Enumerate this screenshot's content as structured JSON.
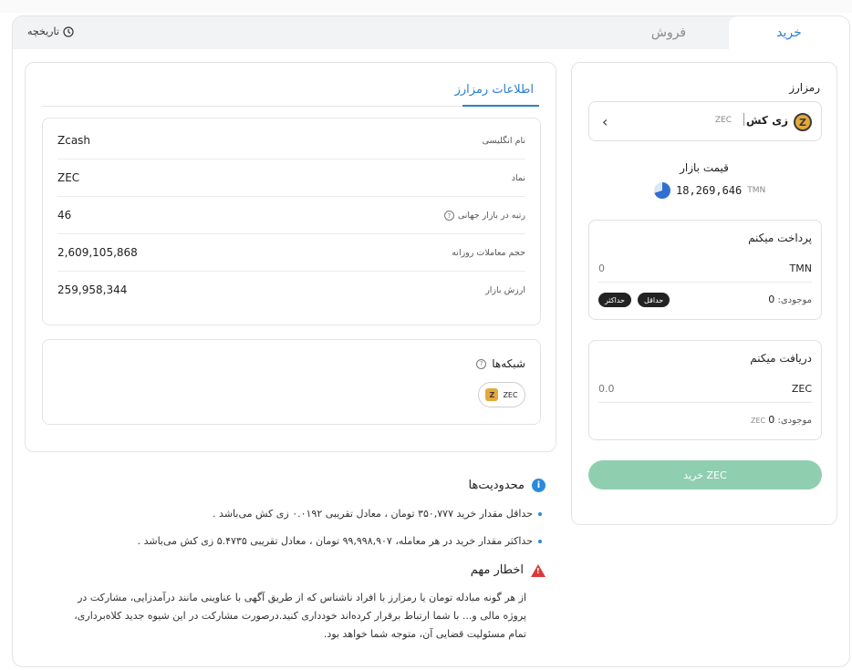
{
  "tabs": {
    "buy": "خرید",
    "sell": "فروش",
    "history": "تاریخچه"
  },
  "trade": {
    "crypto_label": "رمزارز",
    "coin_name": "زی کش",
    "coin_symbol": "ZEC",
    "coin_logo_letter": "Z",
    "market_price_label": "قیمت بازار",
    "market_price_value": "18,269,646",
    "market_price_unit": "TMN",
    "pay": {
      "title": "پرداخت میکنم",
      "value": "0",
      "currency": "TMN",
      "balance_label": "موجودی:",
      "balance_value": "0",
      "min_label": "حداقل",
      "max_label": "حداکثر"
    },
    "receive": {
      "title": "دریافت میکنم",
      "value": "0.0",
      "currency": "ZEC",
      "balance_label": "موجودی:",
      "balance_unit": "ZEC",
      "balance_value": "0"
    },
    "buy_button": "خرید ZEC"
  },
  "info": {
    "tab_label": "اطلاعات رمزارز",
    "rows": [
      {
        "key": "نام انگلیسی",
        "value": "Zcash"
      },
      {
        "key": "نماد",
        "value": "ZEC"
      },
      {
        "key": "رتبه در بازار جهانی",
        "value": "46"
      },
      {
        "key": "حجم معاملات روزانه",
        "value": "2,609,105,868"
      },
      {
        "key": "ارزش بازار",
        "value": "259,958,344"
      }
    ],
    "networks_label": "شبکه‌ها",
    "network_chip": "ZEC"
  },
  "restrictions": {
    "title": "محدودیت‌ها",
    "items": [
      "حداقل مقدار خرید ۳۵۰,۷۷۷ تومان ، معادل تقریبی ۰.۰۱۹۲ زی کش می‌باشد .",
      "حداکثر مقدار خرید در هر معامله، ۹۹,۹۹۸,۹۰۷ تومان ، معادل تقریبی ۵.۴۷۳۵ زی کش می‌باشد ."
    ]
  },
  "warning": {
    "title": "اخطار مهم",
    "lines": [
      "از هر گونه مبادله تومان یا رمزارز با افراد ناشناس که از طریق آگهی با عناوینی مانند درآمدزایی، مشارکت در",
      "پروژه مالی و... با شما ارتباط برقرار کرده‌اند خودداری کنید.درصورت مشارکت در این شیوه جدید کلاه‌برداری،",
      "تمام مسئولیت قضایی آن، متوجه شما خواهد بود."
    ]
  },
  "colors": {
    "accent": "#2b7fd0",
    "buy_button": "#8fcfb0",
    "warning": "#d93a3a"
  }
}
